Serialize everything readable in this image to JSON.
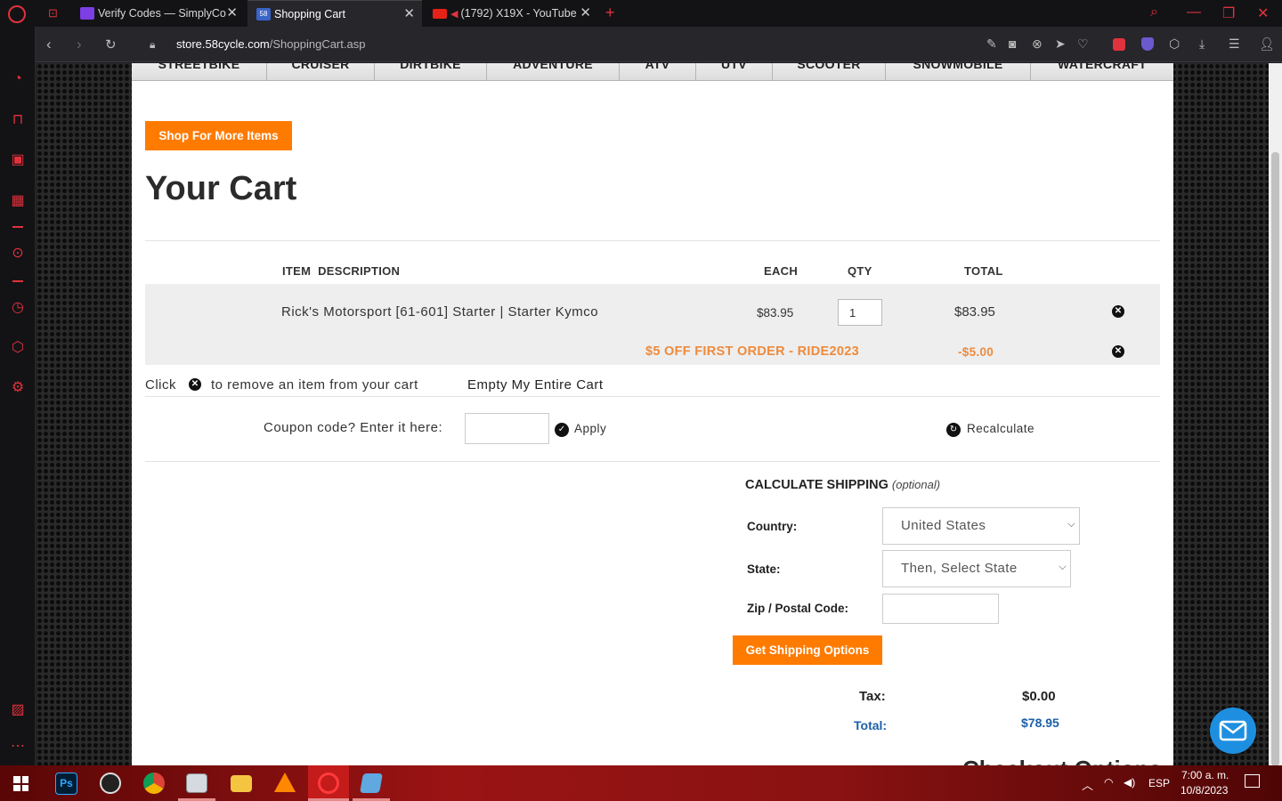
{
  "browser": {
    "tabs": [
      {
        "title": "",
        "favicon": "gamepad-icon"
      },
      {
        "title": "Verify Codes — SimplyCodes",
        "favicon": "simplycodes-icon"
      },
      {
        "title": "Shopping Cart",
        "favicon": "58-icon"
      },
      {
        "title": "(1792) X19X - YouTube",
        "favicon": "youtube-icon"
      }
    ],
    "url_host": "store.58cycle.com",
    "url_path": "/ShoppingCart.asp"
  },
  "catnav": [
    "STREETBIKE",
    "CRUISER",
    "DIRTBIKE",
    "ADVENTURE",
    "ATV",
    "UTV",
    "SCOOTER",
    "SNOWMOBILE",
    "WATERCRAFT"
  ],
  "cart": {
    "shop_more": "Shop For More Items",
    "title": "Your Cart",
    "columns": {
      "desc": "ITEM  DESCRIPTION",
      "each": "EACH",
      "qty": "QTY",
      "total": "TOTAL"
    },
    "item": {
      "desc": "Rick's Motorsport [61-601] Starter | Starter Kymco",
      "each": "$83.95",
      "qty": "1",
      "total": "$83.95"
    },
    "promo": {
      "label": "$5 OFF FIRST ORDER - RIDE2023",
      "amount": "-$5.00"
    },
    "remove_hint_pre": "Click",
    "remove_hint_post": "to remove an item from your cart",
    "empty_cart": "Empty My Entire Cart",
    "coupon_label": "Coupon code? Enter it here:",
    "apply": "Apply",
    "recalculate": "Recalculate"
  },
  "shipping": {
    "heading": "CALCULATE SHIPPING",
    "heading_note": "(optional)",
    "country_label": "Country:",
    "country_value": "United States",
    "state_label": "State:",
    "state_value": "Then, Select State",
    "zip_label": "Zip / Postal Code:",
    "button": "Get Shipping Options",
    "tax_label": "Tax:",
    "tax_value": "$0.00",
    "total_label": "Total:",
    "total_value": "$78.95",
    "checkout_heading": "Checkout Options"
  },
  "tray": {
    "lang": "ESP",
    "time": "7:00 a. m.",
    "date": "10/8/2023"
  },
  "colors": {
    "accent": "#ff7b00",
    "promo": "#ee8b3c",
    "total_blue": "#1b5fa8",
    "opera_red": "#e0323c"
  }
}
